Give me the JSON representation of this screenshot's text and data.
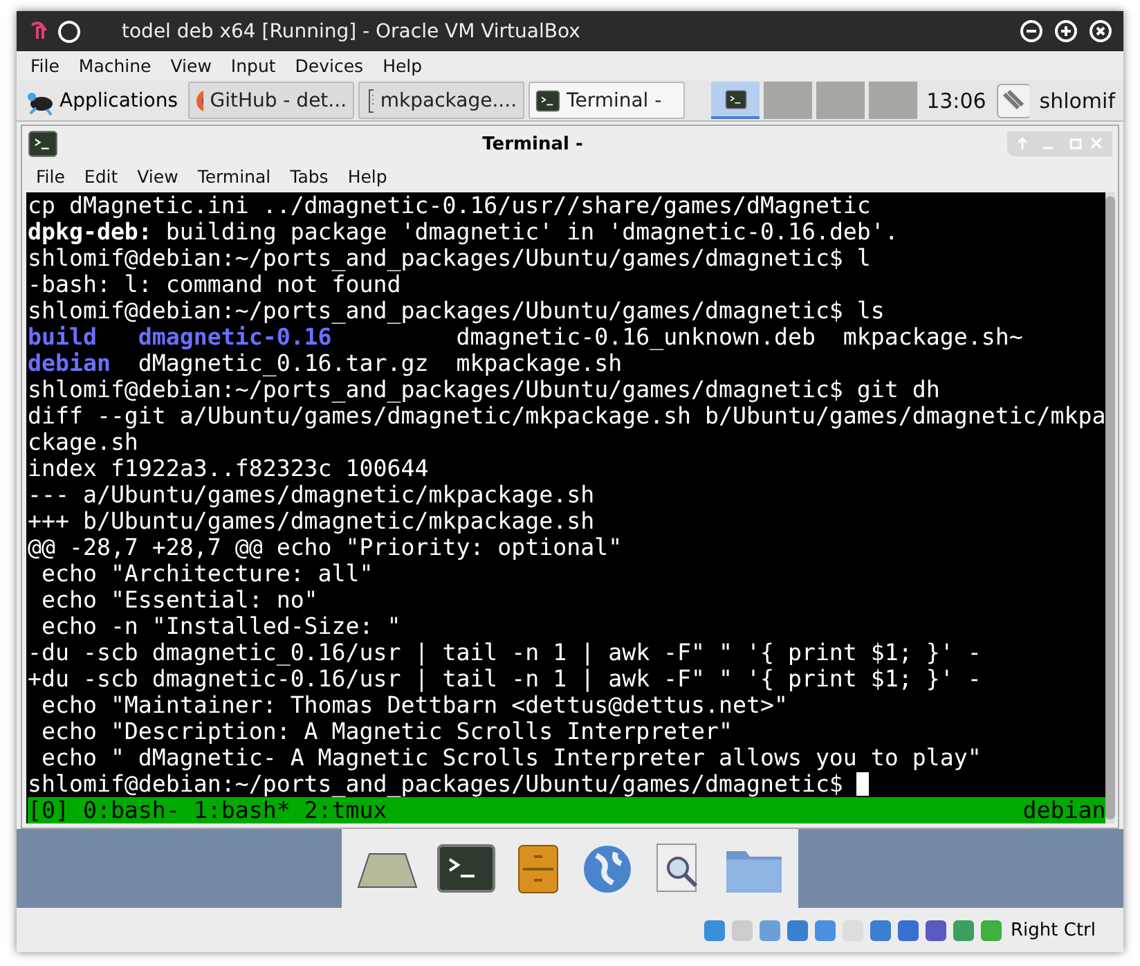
{
  "window": {
    "title": "todel deb x64 [Running] - Oracle VM VirtualBox"
  },
  "menu": [
    "File",
    "Machine",
    "View",
    "Input",
    "Devices",
    "Help"
  ],
  "panel": {
    "applications": "Applications",
    "tasks": [
      {
        "label": "GitHub - det...",
        "kind": "browser",
        "selected": false
      },
      {
        "label": "mkpackage....",
        "kind": "editor",
        "selected": false
      },
      {
        "label": "Terminal -",
        "kind": "terminal",
        "selected": true
      }
    ],
    "workspaces": [
      {
        "selected": true
      },
      {
        "selected": false
      },
      {
        "selected": false
      },
      {
        "selected": false
      }
    ],
    "clock": "13:06",
    "user": "shlomif"
  },
  "terminal": {
    "title": "Terminal -",
    "menu": [
      "File",
      "Edit",
      "View",
      "Terminal",
      "Tabs",
      "Help"
    ],
    "lines": [
      [
        {
          "text": "cp dMagnetic.ini ../dmagnetic-0.16/usr//share/games/dMagnetic",
          "kind": "plain"
        }
      ],
      [
        {
          "text": "dpkg-deb:",
          "kind": "bold"
        },
        {
          "text": " building package 'dmagnetic' in 'dmagnetic-0.16.deb'.",
          "kind": "plain"
        }
      ],
      [
        {
          "text": "shlomif@debian:~/ports_and_packages/Ubuntu/games/dmagnetic$ l",
          "kind": "plain"
        }
      ],
      [
        {
          "text": "-bash: l: command not found",
          "kind": "plain"
        }
      ],
      [
        {
          "text": "shlomif@debian:~/ports_and_packages/Ubuntu/games/dmagnetic$ ls",
          "kind": "plain"
        }
      ],
      [
        {
          "text": "build",
          "kind": "dir"
        },
        {
          "text": "   dmagnetic-0.16",
          "kind": "dir"
        },
        {
          "text": "         dmagnetic-0.16_unknown.deb  mkpackage.sh~",
          "kind": "plain"
        }
      ],
      [
        {
          "text": "debian",
          "kind": "dir"
        },
        {
          "text": "  dMagnetic_0.16.tar.gz  mkpackage.sh",
          "kind": "plain"
        }
      ],
      [
        {
          "text": "shlomif@debian:~/ports_and_packages/Ubuntu/games/dmagnetic$ git dh",
          "kind": "plain"
        }
      ],
      [
        {
          "text": "diff --git a/Ubuntu/games/dmagnetic/mkpackage.sh b/Ubuntu/games/dmagnetic/mkpa",
          "kind": "plain"
        }
      ],
      [
        {
          "text": "ckage.sh",
          "kind": "plain"
        }
      ],
      [
        {
          "text": "index f1922a3..f82323c 100644",
          "kind": "plain"
        }
      ],
      [
        {
          "text": "--- a/Ubuntu/games/dmagnetic/mkpackage.sh",
          "kind": "plain"
        }
      ],
      [
        {
          "text": "+++ b/Ubuntu/games/dmagnetic/mkpackage.sh",
          "kind": "plain"
        }
      ],
      [
        {
          "text": "@@ -28,7 +28,7 @@ echo \"Priority: optional\"",
          "kind": "plain"
        }
      ],
      [
        {
          "text": " echo \"Architecture: all\"",
          "kind": "plain"
        }
      ],
      [
        {
          "text": " echo \"Essential: no\"",
          "kind": "plain"
        }
      ],
      [
        {
          "text": " echo -n \"Installed-Size: \"",
          "kind": "plain"
        }
      ],
      [
        {
          "text": "-du -scb dmagnetic_0.16/usr | tail -n 1 | awk -F\" \" '{ print $1; }' -",
          "kind": "plain"
        }
      ],
      [
        {
          "text": "+du -scb dmagnetic-0.16/usr | tail -n 1 | awk -F\" \" '{ print $1; }' -",
          "kind": "plain"
        }
      ],
      [
        {
          "text": " echo \"Maintainer: Thomas Dettbarn <dettus@dettus.net>\"",
          "kind": "plain"
        }
      ],
      [
        {
          "text": " echo \"Description: A Magnetic Scrolls Interpreter\"",
          "kind": "plain"
        }
      ],
      [
        {
          "text": " echo \" dMagnetic- A Magnetic Scrolls Interpreter allows you to play\"",
          "kind": "plain"
        }
      ],
      [
        {
          "text": "shlomif@debian:~/ports_and_packages/Ubuntu/games/dmagnetic$ ",
          "kind": "plain"
        },
        {
          "kind": "cursor"
        }
      ]
    ],
    "tmux": {
      "windows": "[0] 0:bash- 1:bash* 2:tmux",
      "host": "debian"
    }
  },
  "statusbar": {
    "hostkey": "Right Ctrl"
  }
}
